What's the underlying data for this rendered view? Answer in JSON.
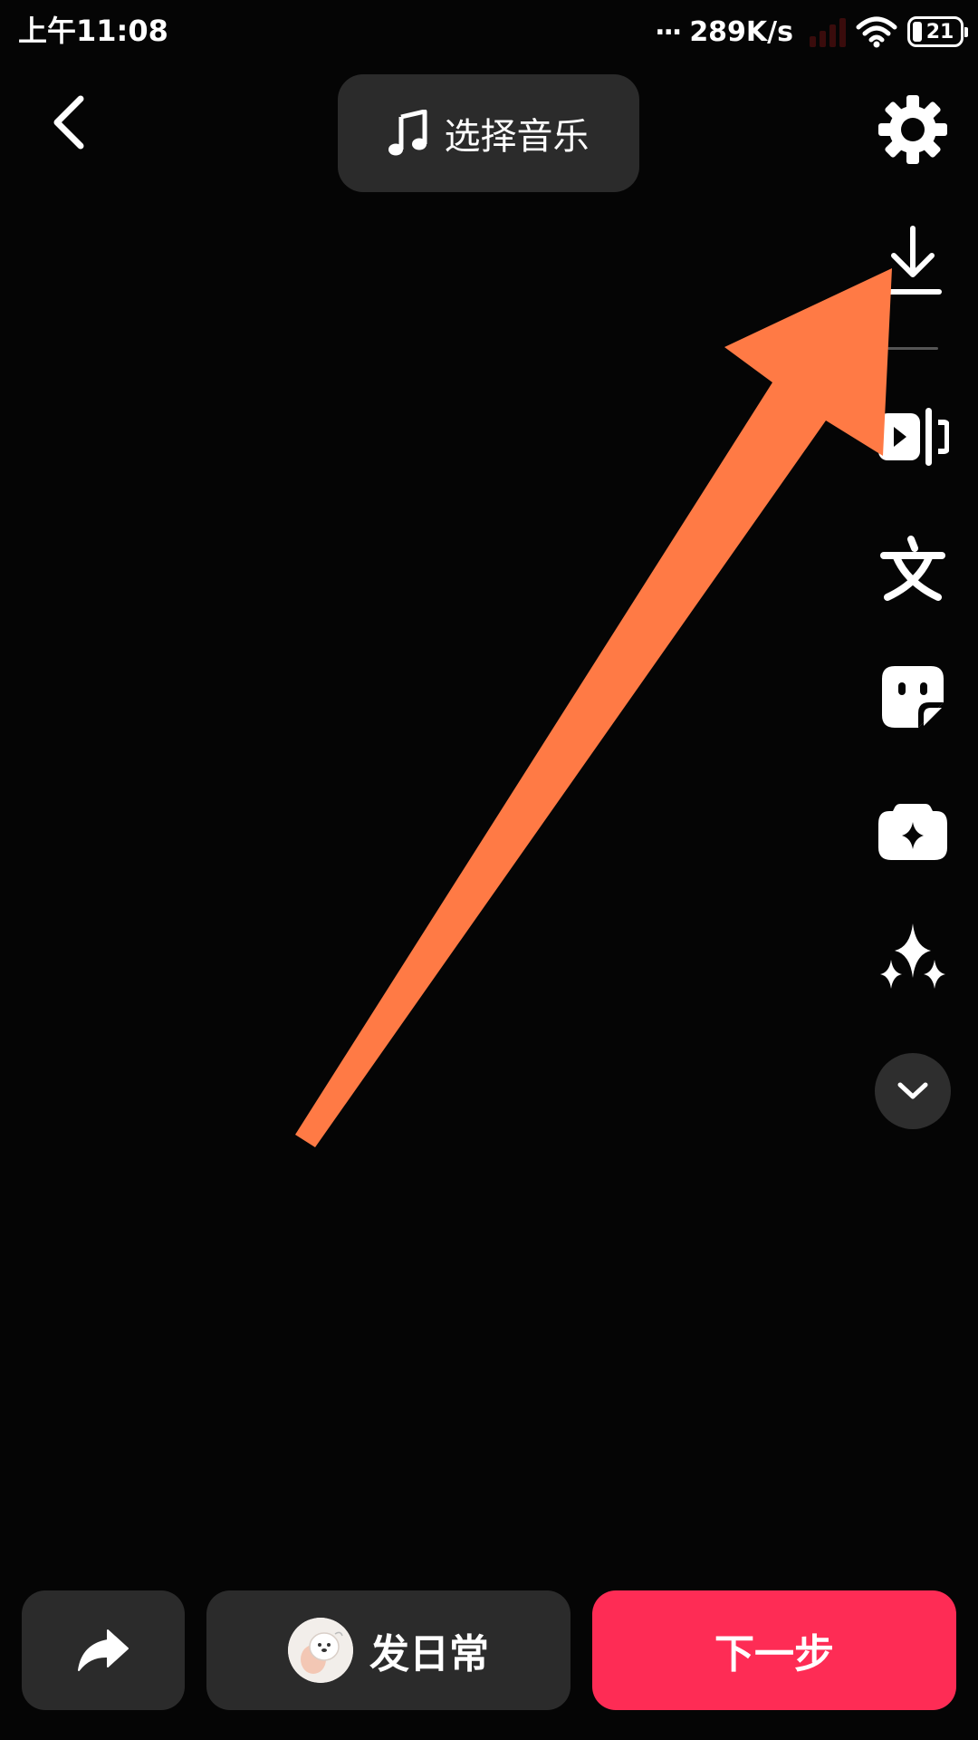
{
  "status_bar": {
    "time": "上午11:08",
    "network_dots": "...",
    "network_speed": "289K/s",
    "battery_level": "21"
  },
  "header": {
    "back_icon": "chevron-left-icon",
    "music_button_label": "选择音乐",
    "music_icon": "music-note-icon"
  },
  "toolbar": {
    "items": [
      {
        "icon": "gear-icon"
      },
      {
        "icon": "download-icon"
      },
      {
        "icon": "clip-video-icon"
      },
      {
        "icon": "text-icon"
      },
      {
        "icon": "sticker-icon"
      },
      {
        "icon": "effects-icon"
      },
      {
        "icon": "sparkle-icon"
      },
      {
        "icon": "chevron-down-icon"
      }
    ]
  },
  "annotation": {
    "arrow_color": "#ff7a45",
    "points_to": "download-icon"
  },
  "bottom_bar": {
    "share_icon": "share-arrow-icon",
    "daily_label": "发日常",
    "next_label": "下一步"
  },
  "colors": {
    "background": "#050505",
    "panel": "#2b2b2b",
    "accent": "#fe2c55",
    "arrow": "#ff7a45"
  }
}
